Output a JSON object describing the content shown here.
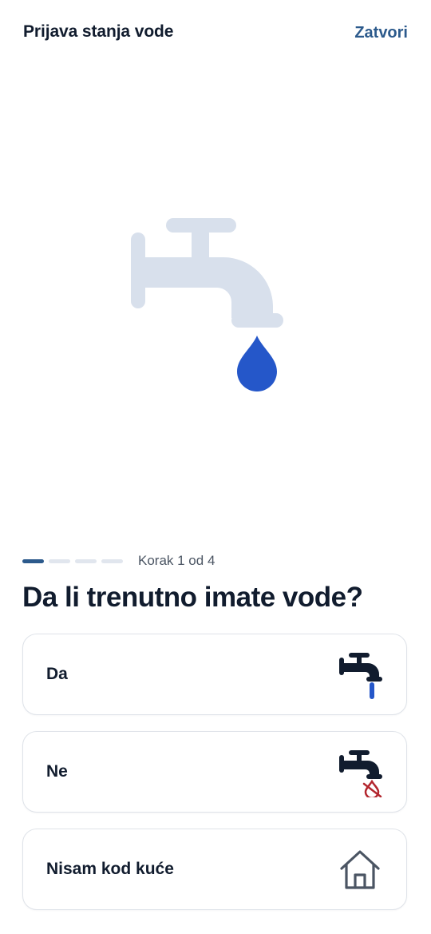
{
  "header": {
    "title": "Prijava stanja vode",
    "close_label": "Zatvori"
  },
  "hero": {
    "icon": "faucet-drop-icon",
    "faucet_color": "#d8e0ec",
    "drop_color": "#2557c9"
  },
  "progress": {
    "current_step": 1,
    "total_steps": 4,
    "label": "Korak 1 od 4"
  },
  "question": "Da li trenutno imate vode?",
  "options": [
    {
      "label": "Da",
      "icon": "faucet-running-icon"
    },
    {
      "label": "Ne",
      "icon": "faucet-no-water-icon"
    },
    {
      "label": "Nisam kod kuće",
      "icon": "house-icon"
    }
  ],
  "colors": {
    "accent": "#2c5a8c",
    "text": "#111c2e",
    "water": "#2557c9",
    "no_water": "#b3262e",
    "border": "#dfe3e9"
  }
}
